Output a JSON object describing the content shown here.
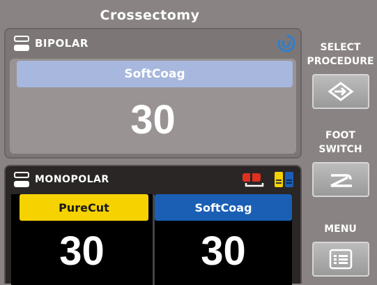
{
  "screen": {
    "title": "Crossectomy"
  },
  "bipolar": {
    "label": "BIPOLAR",
    "mode": "SoftCoag",
    "value": "30",
    "mode_color": "#a7b7dd"
  },
  "monopolar": {
    "label": "MONOPOLAR",
    "cut": {
      "mode": "PureCut",
      "value": "30",
      "color": "#f6d200"
    },
    "coag": {
      "mode": "SoftCoag",
      "value": "30",
      "color": "#1a5fb4"
    }
  },
  "sidebar": {
    "select_procedure": "SELECT PROCEDURE",
    "foot_switch": "FOOT SWITCH",
    "menu": "MENU"
  },
  "icons": {
    "bipolar_channel": "channel-icon",
    "swirl": "autostart-icon",
    "monopolar_channel": "channel-icon",
    "footswitch_red": "red-footswitch-icon",
    "footswitch_yellow_blue": "yellow-blue-footswitch-icon",
    "select_procedure": "arrow-right-diamond-icon",
    "foot_switch": "pedal-icon",
    "menu": "list-icon"
  }
}
